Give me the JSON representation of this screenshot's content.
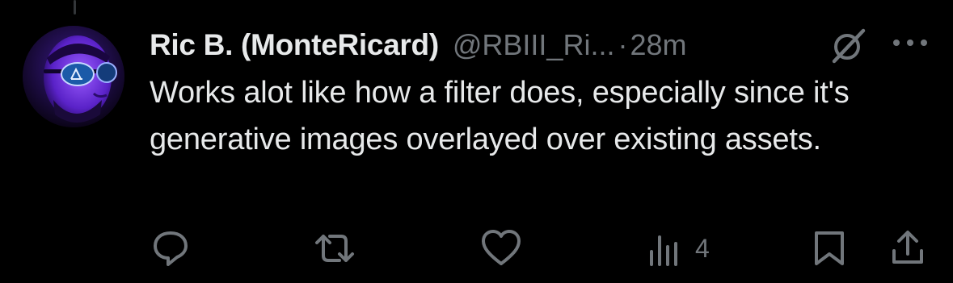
{
  "tweet": {
    "display_name": "Ric B. (MonteRicard)",
    "handle": "@RBIII_Ri...",
    "separator": "·",
    "timestamp": "28m",
    "text": "Works alot like how a filter does, especially since it's generative images overlayed over existing assets."
  },
  "actions": {
    "views": "4"
  },
  "icons": {
    "grok": "grok-slash-circle-icon",
    "more": "more-horizontal-icon",
    "reply": "reply-bubble-icon",
    "retweet": "retweet-arrows-icon",
    "like": "heart-icon",
    "views": "analytics-bars-icon",
    "bookmark": "bookmark-icon",
    "share": "share-upload-icon"
  },
  "colors": {
    "background": "#000000",
    "primary_text": "#e7e9ea",
    "secondary_text": "#71767b",
    "avatar_tint": "#7a3cff"
  }
}
